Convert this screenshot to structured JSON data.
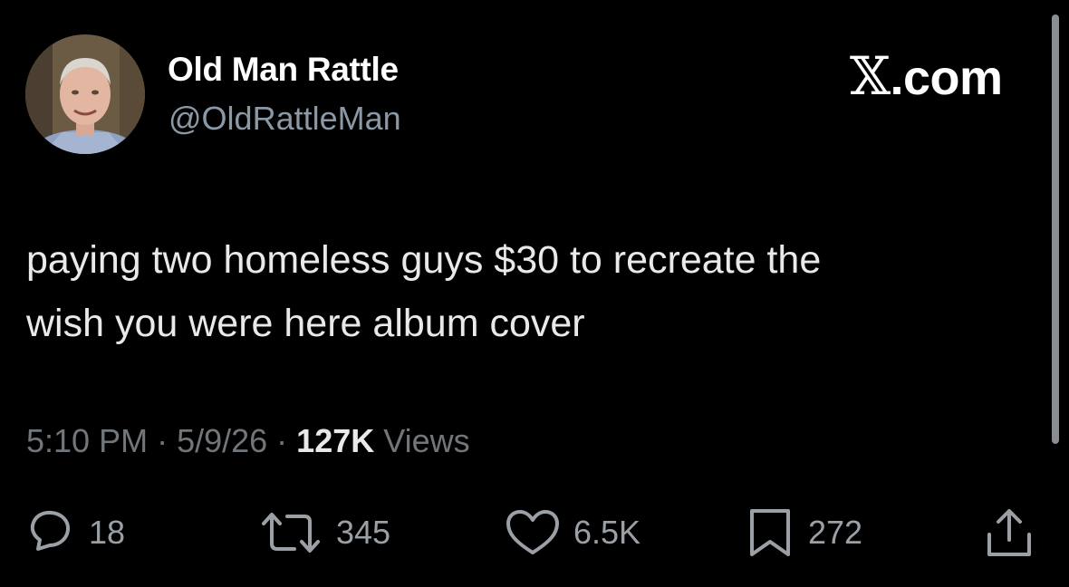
{
  "tweet": {
    "author": {
      "display_name": "Old Man Rattle",
      "handle": "@OldRattleMan",
      "avatar_icon": "person-photo-avatar"
    },
    "brand": {
      "glyph": "𝕏",
      "suffix": ".com"
    },
    "text": "paying two homeless guys $30 to recreate the\nwish you were here album cover",
    "meta": {
      "time": "5:10 PM",
      "separator": " · ",
      "date": "5/9/26",
      "views_count": "127K",
      "views_label": " Views"
    },
    "actions": {
      "replies": {
        "icon": "reply-bubble-icon",
        "count": "18"
      },
      "reposts": {
        "icon": "retweet-icon",
        "count": "345"
      },
      "likes": {
        "icon": "heart-icon",
        "count": "6.5K"
      },
      "bookmarks": {
        "icon": "bookmark-icon",
        "count": "272"
      },
      "share": {
        "icon": "share-icon"
      }
    }
  },
  "colors": {
    "background": "#000000",
    "primary_text": "#e7e9ea",
    "secondary_text": "#71767b",
    "icon": "#9aa0a6"
  }
}
